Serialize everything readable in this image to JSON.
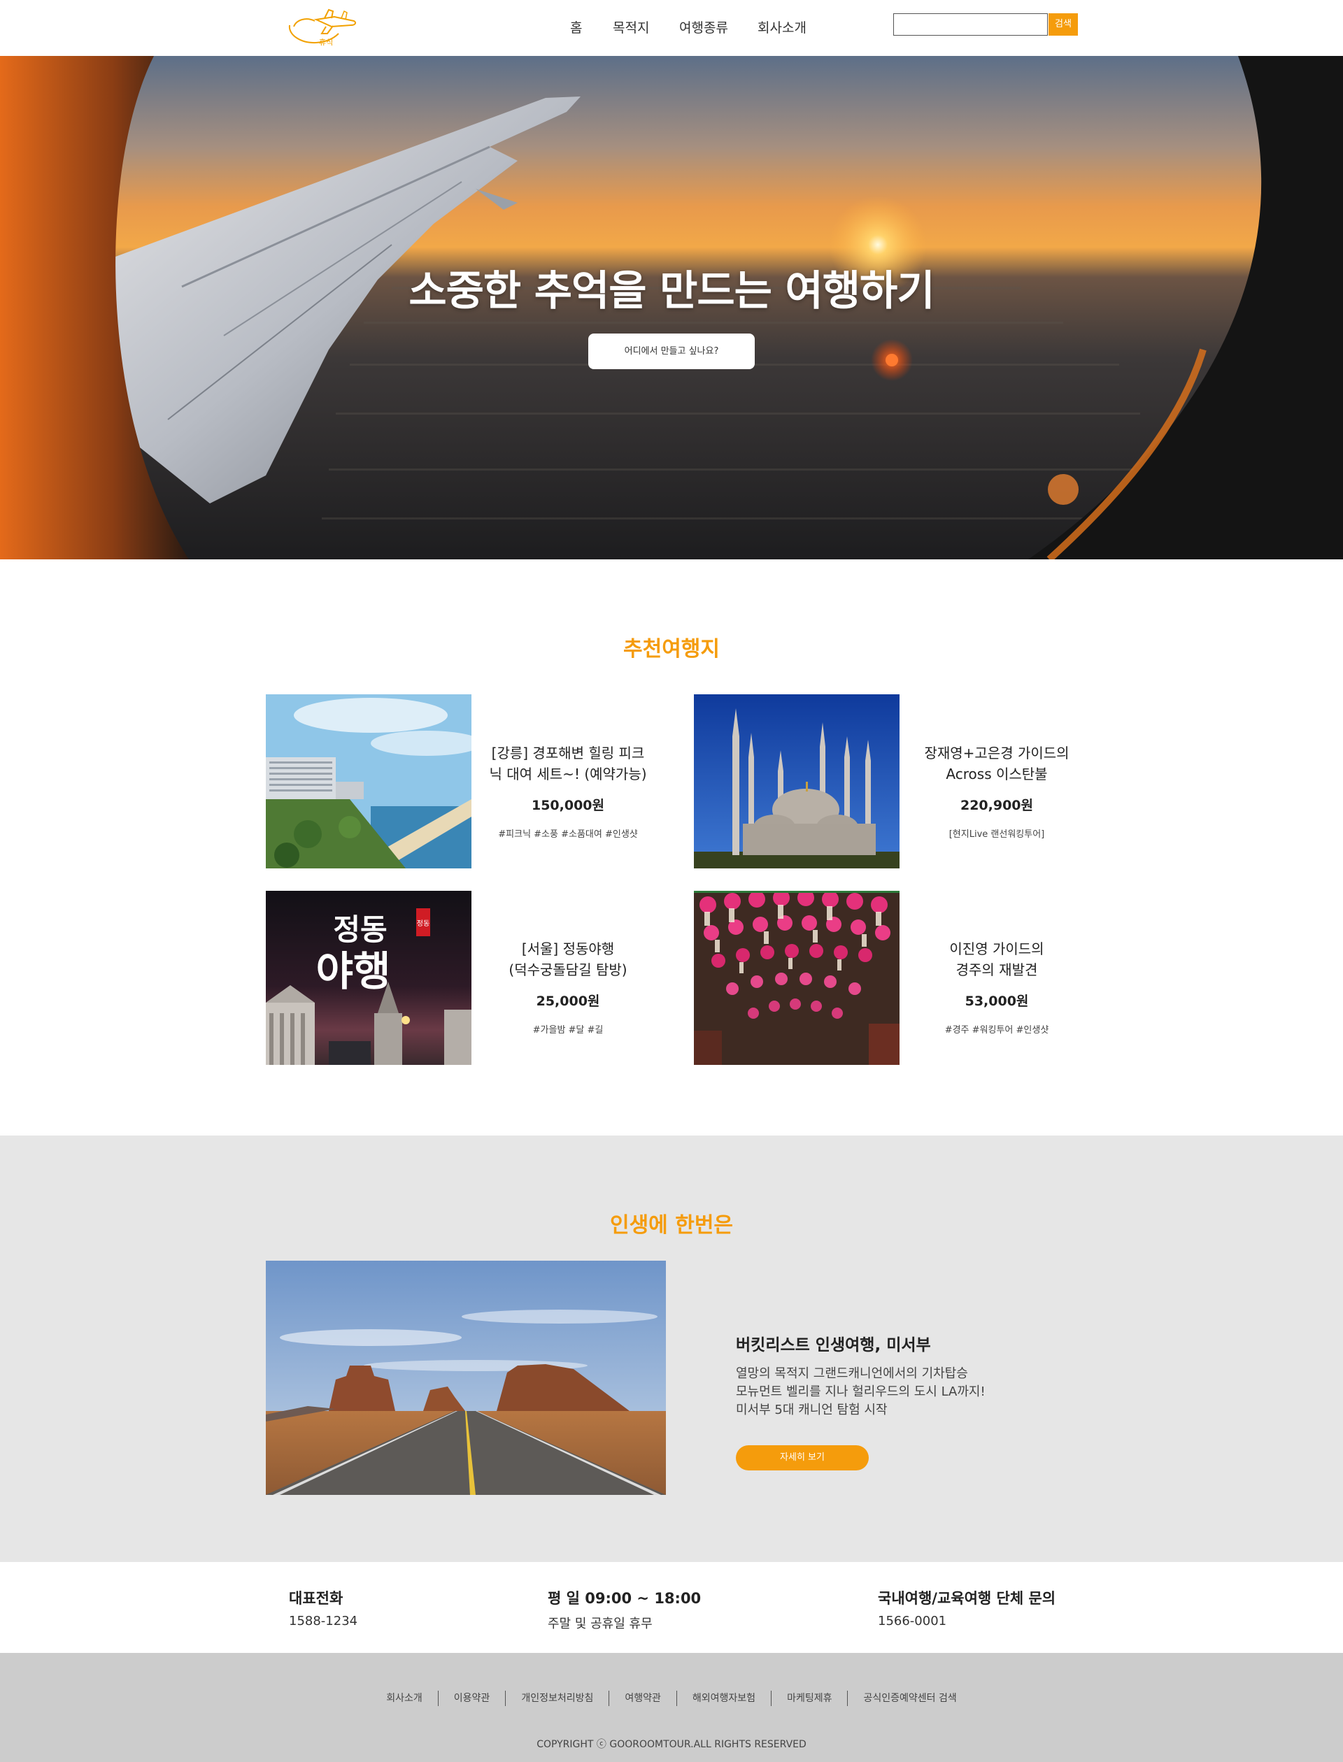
{
  "header": {
    "logo_text": "휴식",
    "nav": [
      {
        "label": "홈"
      },
      {
        "label": "목적지"
      },
      {
        "label": "여행종류"
      },
      {
        "label": "회사소개"
      }
    ],
    "search": {
      "placeholder": "",
      "button": "검색"
    }
  },
  "hero": {
    "title": "소중한 추억을 만드는 여행하기",
    "button": "어디에서 만들고 싶나요?"
  },
  "recommend": {
    "title": "추천여행지",
    "cards": [
      {
        "title_line1": "[강릉] 경포해변 힐링 피크",
        "title_line2": "닉 대여 세트~! (예약가능)",
        "price": "150,000원",
        "tags": "#피크닉 #소풍 #소품대여 #인생샷"
      },
      {
        "title_line1": "장재영+고은경 가이드의",
        "title_line2": "Across 이스탄불",
        "price": "220,900원",
        "tags": "[현지Live 랜선워킹투어]"
      },
      {
        "title_line1": "[서울] 정동야행",
        "title_line2": "(덕수궁돌담길 탐방)",
        "price": "25,000원",
        "tags": "#가을밤 #달 #길"
      },
      {
        "title_line1": "이진영 가이드의",
        "title_line2": "경주의 재발견",
        "price": "53,000원",
        "tags": "#경주 #워킹투어 #인생샷"
      }
    ],
    "poster_text": {
      "main_top": "정동",
      "main_bottom": "야행",
      "seal": "정동"
    }
  },
  "life": {
    "title": "인생에 한번은",
    "headline": "버킷리스트 인생여행, 미서부",
    "desc": [
      "열망의 목적지 그랜드캐니언에서의 기차탑승",
      "모뉴먼트 벨리를 지나 헐리우드의 도시 LA까지!",
      "미서부 5대 캐니언 탐험 시작"
    ],
    "button": "자세히 보기"
  },
  "info": [
    {
      "title": "대표전화",
      "sub": "1588-1234"
    },
    {
      "title": "평 일 09:00 ~ 18:00",
      "sub": "주말 및 공휴일 휴무"
    },
    {
      "title": "국내여행/교육여행 단체 문의",
      "sub": "1566-0001"
    }
  ],
  "footer": {
    "links": [
      "회사소개",
      "이용약관",
      "개인정보처리방침",
      "여행약관",
      "해외여행자보험",
      "마케팅제휴",
      "공식인증예약센터 검색"
    ],
    "copyright": "COPYRIGHT ⓒ GOOROOMTOUR.ALL RIGHTS RESERVED"
  },
  "colors": {
    "accent": "#f59c0c",
    "gray_section": "#e6e6e6",
    "footer_bg": "#cccccc"
  }
}
